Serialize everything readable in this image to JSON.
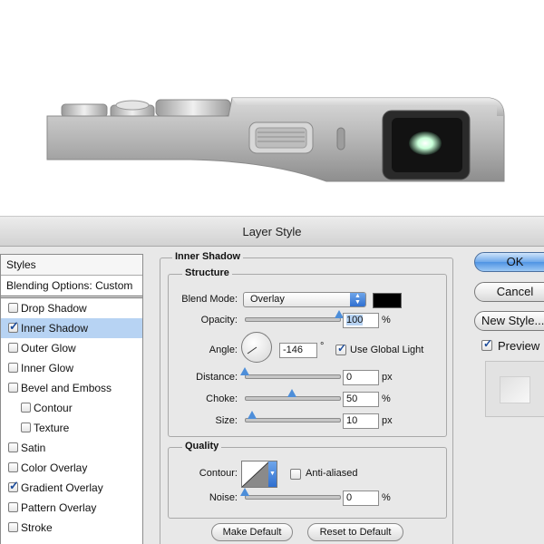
{
  "dialog": {
    "title": "Layer Style"
  },
  "styles_panel": {
    "header": "Styles",
    "blending_options": "Blending Options: Custom",
    "items": [
      {
        "label": "Drop Shadow",
        "checked": false,
        "selected": false,
        "indent": false
      },
      {
        "label": "Inner Shadow",
        "checked": true,
        "selected": true,
        "indent": false
      },
      {
        "label": "Outer Glow",
        "checked": false,
        "selected": false,
        "indent": false
      },
      {
        "label": "Inner Glow",
        "checked": false,
        "selected": false,
        "indent": false
      },
      {
        "label": "Bevel and Emboss",
        "checked": false,
        "selected": false,
        "indent": false
      },
      {
        "label": "Contour",
        "checked": false,
        "selected": false,
        "indent": true
      },
      {
        "label": "Texture",
        "checked": false,
        "selected": false,
        "indent": true
      },
      {
        "label": "Satin",
        "checked": false,
        "selected": false,
        "indent": false
      },
      {
        "label": "Color Overlay",
        "checked": false,
        "selected": false,
        "indent": false
      },
      {
        "label": "Gradient Overlay",
        "checked": true,
        "selected": false,
        "indent": false
      },
      {
        "label": "Pattern Overlay",
        "checked": false,
        "selected": false,
        "indent": false
      },
      {
        "label": "Stroke",
        "checked": false,
        "selected": false,
        "indent": false
      }
    ]
  },
  "inner_shadow": {
    "section_title": "Inner Shadow",
    "structure": {
      "title": "Structure",
      "blend_mode_label": "Blend Mode:",
      "blend_mode_value": "Overlay",
      "shadow_color": "#000000",
      "opacity_label": "Opacity:",
      "opacity_value": "100",
      "opacity_unit": "%",
      "opacity_fraction": 1.0,
      "angle_label": "Angle:",
      "angle_value": "-146",
      "angle_unit": "°",
      "use_global_light_label": "Use Global Light",
      "use_global_light": true,
      "distance_label": "Distance:",
      "distance_value": "0",
      "distance_unit": "px",
      "distance_fraction": 0.0,
      "choke_label": "Choke:",
      "choke_value": "50",
      "choke_unit": "%",
      "choke_fraction": 0.5,
      "size_label": "Size:",
      "size_value": "10",
      "size_unit": "px",
      "size_fraction": 0.08
    },
    "quality": {
      "title": "Quality",
      "contour_label": "Contour:",
      "anti_aliased_label": "Anti-aliased",
      "anti_aliased": false,
      "noise_label": "Noise:",
      "noise_value": "0",
      "noise_unit": "%",
      "noise_fraction": 0.0
    },
    "make_default_label": "Make Default",
    "reset_default_label": "Reset to Default"
  },
  "buttons": {
    "ok": "OK",
    "cancel": "Cancel",
    "new_style": "New Style...",
    "preview_label": "Preview",
    "preview_checked": true
  }
}
